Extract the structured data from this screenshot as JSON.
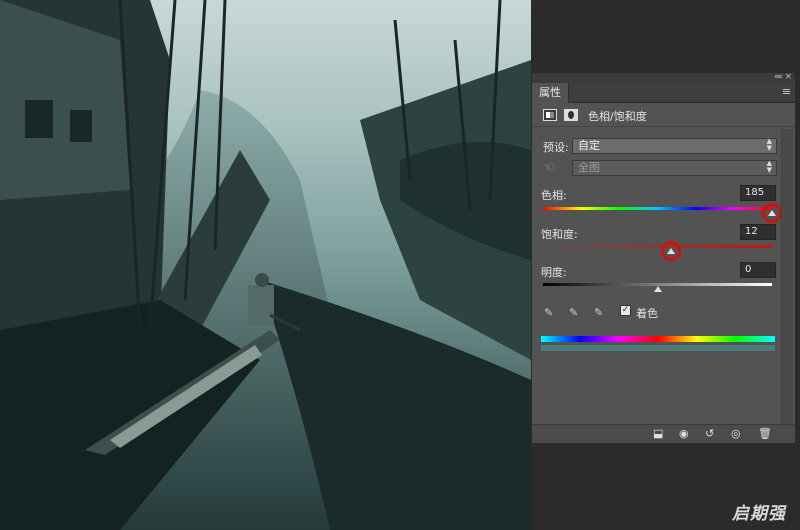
{
  "panel": {
    "tab_label": "属性",
    "adjustment_title": "色相/饱和度",
    "preset_label": "预设:",
    "preset_value": "自定",
    "channel_value": "全图",
    "hue_label": "色相:",
    "hue_value": "185",
    "saturation_label": "饱和度:",
    "saturation_value": "12",
    "lightness_label": "明度:",
    "lightness_value": "0",
    "colorize_label": "着色",
    "colorize_checked": true,
    "check_mark": "✓",
    "collapse_glyph": "««",
    "close_glyph": "×",
    "menu_glyph": "≡"
  },
  "sliders": {
    "hue": {
      "value": 185,
      "min": -180,
      "max": 180
    },
    "saturation": {
      "value": 12,
      "min": -100,
      "max": 100
    },
    "lightness": {
      "value": 0,
      "min": -100,
      "max": 100
    }
  },
  "colors": {
    "photo_tint": "#5e8a87",
    "colorize_bar": "#4f7c7a",
    "annotation_circle": "#d01010",
    "panel_bg": "#535353"
  },
  "icons": {
    "eyedroppers": [
      "eyedropper-icon",
      "eyedropper-plus-icon",
      "eyedropper-minus-icon"
    ],
    "footer": [
      "clip-to-layer-icon",
      "toggle-visibility-prev-icon",
      "reset-icon",
      "eye-icon",
      "trash-icon"
    ]
  },
  "watermark": "启期强"
}
